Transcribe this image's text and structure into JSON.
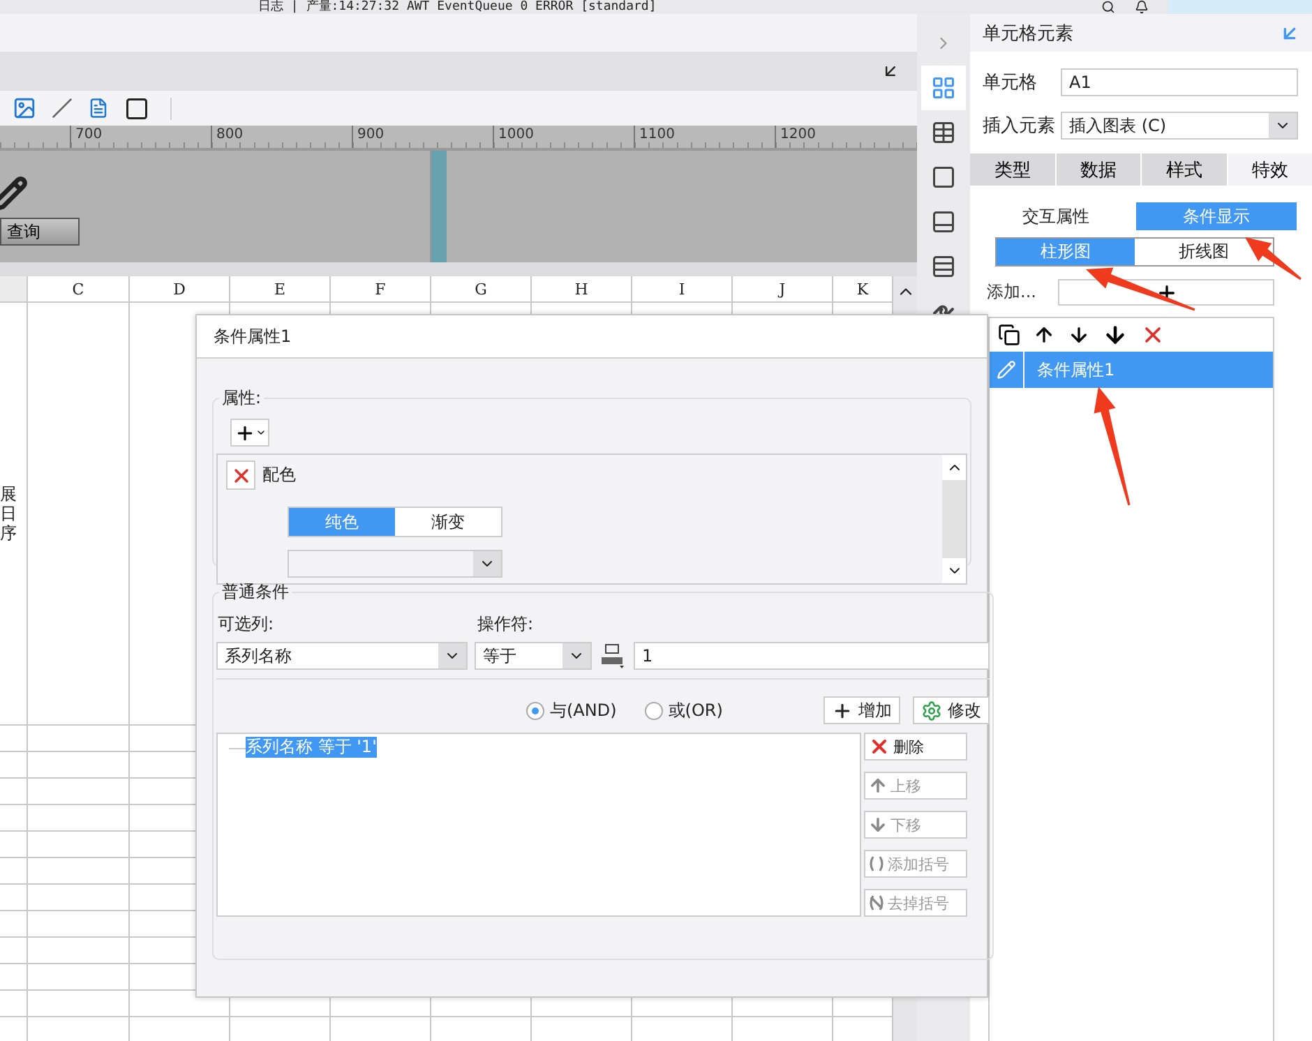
{
  "log_bar": {
    "text": "日志 | 产量:14:27:32 AWT EventQueue 0 ERROR [standard]"
  },
  "ruler": {
    "marks": [
      "700",
      "800",
      "900",
      "1000",
      "1100",
      "1200"
    ]
  },
  "canvas": {
    "query_button": "查询"
  },
  "sheet": {
    "columns": [
      "C",
      "D",
      "E",
      "F",
      "G",
      "H",
      "I",
      "J",
      "K"
    ],
    "cell_lines": [
      "展",
      "日",
      "序"
    ]
  },
  "tool_strip": [
    {
      "kind": "layout",
      "selected": true
    },
    {
      "kind": "info",
      "selected": false
    },
    {
      "kind": "frame",
      "selected": false
    },
    {
      "kind": "dropdown",
      "selected": false
    },
    {
      "kind": "stack",
      "selected": false
    },
    {
      "kind": "link",
      "selected": false
    }
  ],
  "cell_panel": {
    "title": "单元格元素",
    "cell_label": "单元格",
    "cell_value": "A1",
    "insert_label": "插入元素",
    "insert_value": "插入图表 (C)",
    "tabs": [
      {
        "label": "类型",
        "selected": false
      },
      {
        "label": "数据",
        "selected": false
      },
      {
        "label": "样式",
        "selected": false
      },
      {
        "label": "特效",
        "selected": true
      }
    ],
    "subtabs": [
      {
        "label": "交互属性",
        "selected": false
      },
      {
        "label": "条件显示",
        "selected": true
      }
    ],
    "chart_tabs": [
      {
        "label": "柱形图",
        "selected": true
      },
      {
        "label": "折线图",
        "selected": false
      }
    ],
    "add_label": "添加...",
    "list_tools": [
      {
        "kind": "copy"
      },
      {
        "kind": "up"
      },
      {
        "kind": "down"
      },
      {
        "kind": "bottom"
      },
      {
        "kind": "delete"
      }
    ],
    "items": [
      {
        "label": "条件属性1",
        "selected": true
      }
    ]
  },
  "dialog": {
    "title": "条件属性1",
    "attr_group": {
      "legend": "属性:",
      "entries": [
        {
          "label": "配色",
          "modes": [
            {
              "label": "纯色",
              "selected": true
            },
            {
              "label": "渐变",
              "selected": false
            }
          ]
        }
      ]
    },
    "condition_group": {
      "legend": "普通条件",
      "column_label": "可选列:",
      "column_value": "系列名称",
      "operator_label": "操作符:",
      "operator_value": "等于",
      "value": "1",
      "logic": [
        {
          "label": "与(AND)",
          "selected": true
        },
        {
          "label": "或(OR)",
          "selected": false
        }
      ],
      "action_buttons": [
        {
          "label": "增加",
          "kind": "add"
        },
        {
          "label": "修改",
          "kind": "edit"
        }
      ],
      "conditions": [
        {
          "text": "系列名称 等于 '1'",
          "selected": true
        }
      ],
      "side_buttons": [
        {
          "label": "删除",
          "kind": "delete",
          "disabled": false
        },
        {
          "label": "上移",
          "kind": "up",
          "disabled": true
        },
        {
          "label": "下移",
          "kind": "down",
          "disabled": true
        },
        {
          "label": "添加括号",
          "kind": "paren",
          "disabled": true
        },
        {
          "label": "去掉括号",
          "kind": "unparen",
          "disabled": true
        }
      ]
    }
  }
}
